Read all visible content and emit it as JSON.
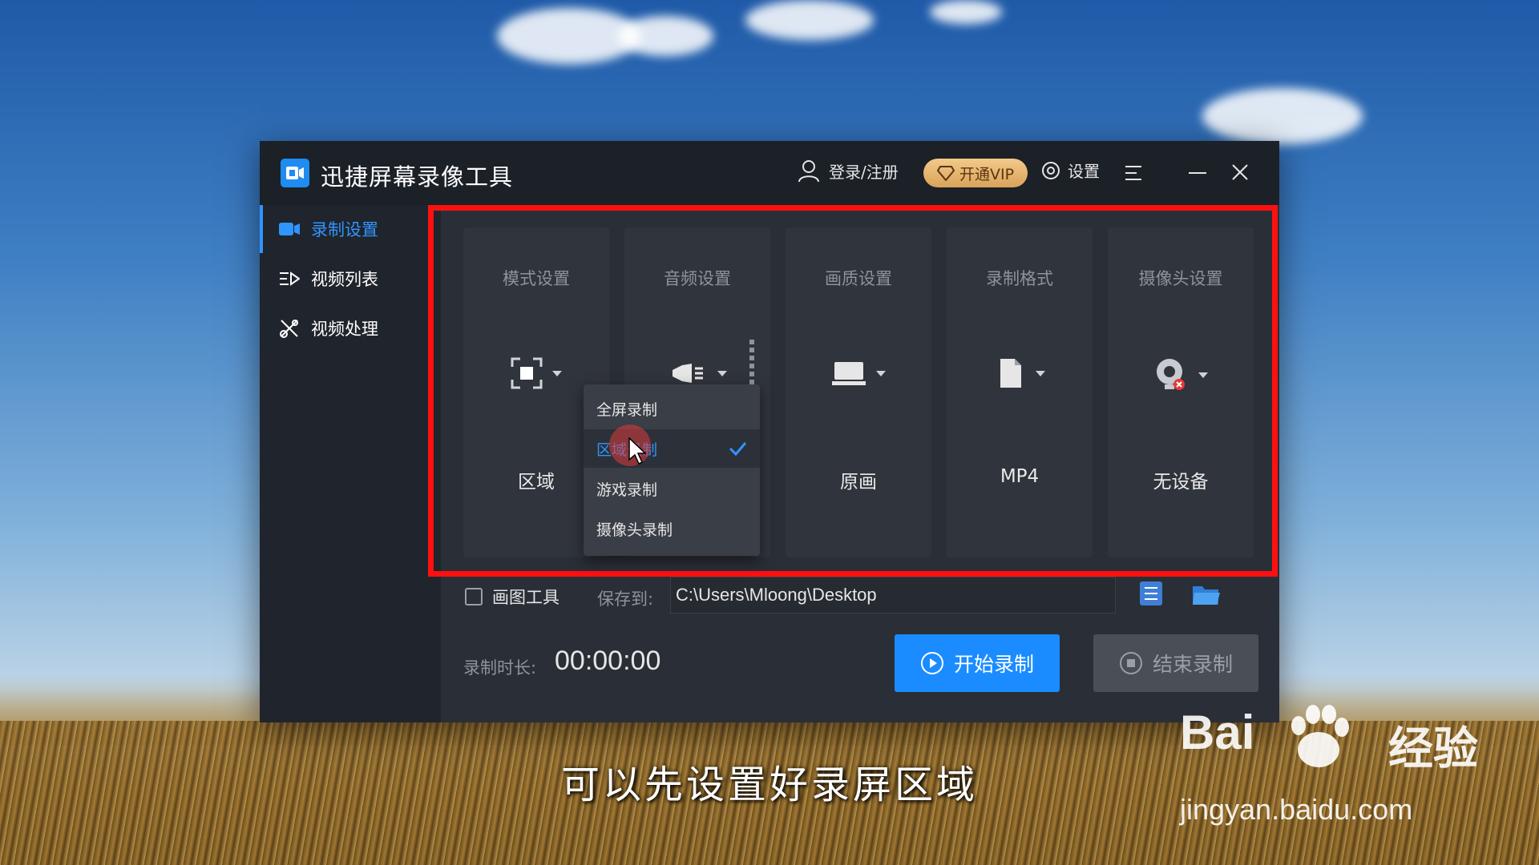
{
  "app": {
    "title": "迅捷屏幕录像工具"
  },
  "titlebar": {
    "login_label": "登录/注册",
    "vip_label": "开通VIP",
    "settings_label": "设置"
  },
  "sidebar": {
    "items": [
      {
        "label": "录制设置",
        "icon": "camera-icon",
        "active": true
      },
      {
        "label": "视频列表",
        "icon": "list-icon",
        "active": false
      },
      {
        "label": "视频处理",
        "icon": "tools-icon",
        "active": false
      }
    ]
  },
  "cards": [
    {
      "title": "模式设置",
      "value": "区域",
      "icon": "region-select-icon"
    },
    {
      "title": "音频设置",
      "value": "",
      "icon": "speaker-icon"
    },
    {
      "title": "画质设置",
      "value": "原画",
      "icon": "monitor-icon"
    },
    {
      "title": "录制格式",
      "value": "MP4",
      "icon": "file-icon"
    },
    {
      "title": "摄像头设置",
      "value": "无设备",
      "icon": "webcam-icon"
    }
  ],
  "mode_dropdown": {
    "options": [
      "全屏录制",
      "区域录制",
      "游戏录制",
      "摄像头录制"
    ],
    "selected_index": 1
  },
  "bottom": {
    "draw_tool_label": "画图工具",
    "save_to_label": "保存到:",
    "save_path": "C:\\Users\\Mloong\\Desktop",
    "duration_label": "录制时长:",
    "duration_value": "00:00:00",
    "start_label": "开始录制",
    "stop_label": "结束录制"
  },
  "overlay": {
    "subtitle": "可以先设置好录屏区域",
    "watermark_brand": "Bai",
    "watermark_cn": "经验",
    "watermark_url": "jingyan.baidu.com"
  },
  "colors": {
    "accent": "#1a8cff",
    "highlight_border": "#ff1010",
    "vip_gold": "#e2b06b"
  }
}
